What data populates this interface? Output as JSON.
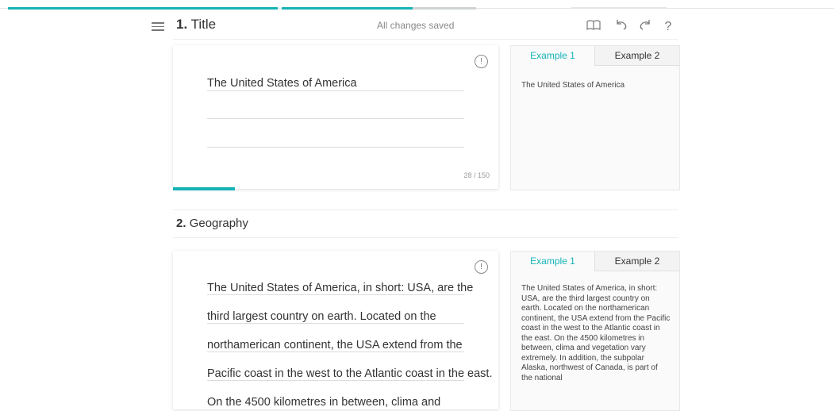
{
  "header": {
    "title_number": "1.",
    "title_label": "Title",
    "status": "All changes saved"
  },
  "section1": {
    "field_value": "The United States of America",
    "counter": "28 / 150",
    "progress_fraction": 0.19,
    "tabs": [
      "Example 1",
      "Example 2"
    ],
    "example_text": "The United States of America"
  },
  "section2": {
    "number": "2.",
    "label": "Geography",
    "lines": [
      "The United States of America, in short: USA, are the",
      "third largest country on earth. Located on the",
      "northamerican continent, the USA extend from the",
      "Pacific coast in the west to the Atlantic coast in the east.",
      "On the 4500 kilometres in between, clima and"
    ],
    "tabs": [
      "Example 1",
      "Example 2"
    ],
    "example_text": "The United States of America, in short: USA, are the third largest country on earth. Located on the northamerican continent, the USA extend from the Pacific coast in the west to the Atlantic coast in the east. On the 4500 kilometres in between, clima and vegetation vary extremely. In addition, the subpolar Alaska, northwest of Canada, is part of the national"
  },
  "icons": [
    "menu-icon",
    "book-icon",
    "undo-icon",
    "redo-icon",
    "help-icon",
    "comment-icon"
  ]
}
